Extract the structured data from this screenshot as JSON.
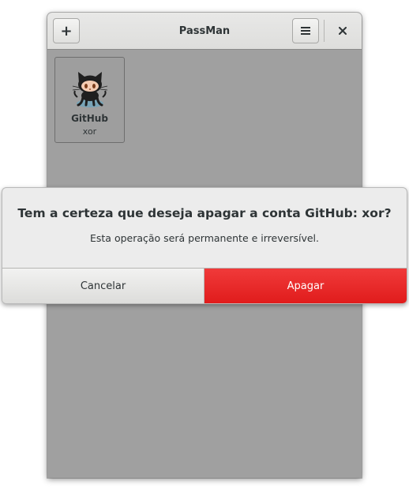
{
  "window": {
    "title": "PassMan",
    "add_button_icon": "plus-icon",
    "menu_button_icon": "hamburger-menu-icon",
    "close_icon": "close-icon"
  },
  "accounts": [
    {
      "service": "GitHub",
      "username": "xor",
      "icon": "github-octocat-icon"
    }
  ],
  "dialog": {
    "title": "Tem a certeza que deseja apagar a conta GitHub: xor?",
    "message": "Esta operação será permanente e irreversível.",
    "cancel_label": "Cancelar",
    "confirm_label": "Apagar"
  },
  "colors": {
    "destructive": "#e01b1b",
    "window_bg": "#a0a0a0",
    "headerbar": "#e0e0de"
  }
}
